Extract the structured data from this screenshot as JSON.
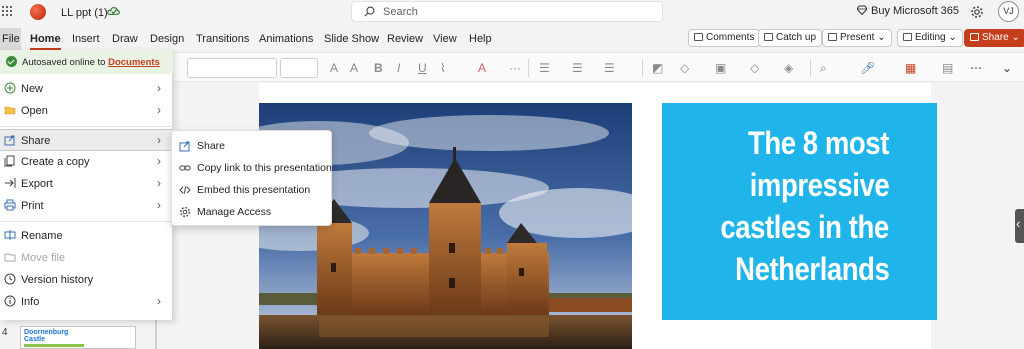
{
  "titlebar": {
    "doc_title": "LL ppt (1)",
    "search_placeholder": "Search",
    "buy_label": "Buy Microsoft 365",
    "avatar_initials": "VJ"
  },
  "tabs": [
    "File",
    "Home",
    "Insert",
    "Draw",
    "Design",
    "Transitions",
    "Animations",
    "Slide Show",
    "Review",
    "View",
    "Help"
  ],
  "active_tab": "Home",
  "ribbon_buttons": {
    "comments": "Comments",
    "catch_up": "Catch up",
    "present": "Present",
    "editing": "Editing",
    "share": "Share"
  },
  "file_menu": {
    "autosave_text": "Autosaved online to",
    "autosave_link": "Documents",
    "items": {
      "new": "New",
      "open": "Open",
      "share": "Share",
      "create_copy": "Create a copy",
      "export": "Export",
      "print": "Print",
      "rename": "Rename",
      "move_file": "Move file",
      "version_history": "Version history",
      "info": "Info"
    }
  },
  "share_submenu": {
    "share": "Share",
    "copy_link": "Copy link to this presentation",
    "embed": "Embed this presentation",
    "manage_access": "Manage Access"
  },
  "slide": {
    "title_lines": [
      "The 8 most",
      "impressive",
      "castles in the",
      "Netherlands"
    ],
    "title_box_color": "#1fb5ea"
  },
  "thumbnail": {
    "number": "4",
    "title_lines": [
      "Doornenburg",
      "Castle"
    ]
  },
  "colors": {
    "accent": "#c43e1c",
    "autosave_bg": "#e9f3e4"
  }
}
